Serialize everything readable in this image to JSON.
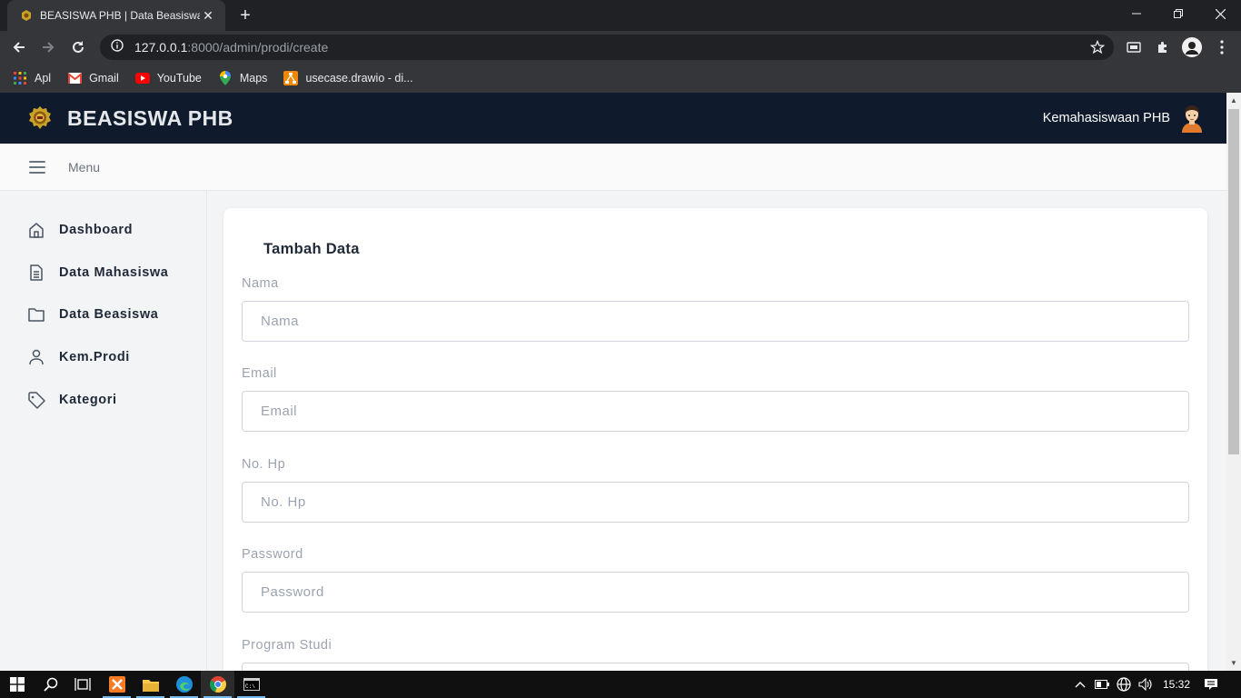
{
  "browser": {
    "tab_title": "BEASISWA PHB | Data Beasiswa",
    "tab_close": "✕",
    "new_tab": "+",
    "url_host": "127.0.0.1",
    "url_rest": ":8000/admin/prodi/create",
    "bookmarks": [
      {
        "label": "Apl",
        "icon": "apps-grid-icon"
      },
      {
        "label": "Gmail",
        "icon": "gmail-icon"
      },
      {
        "label": "YouTube",
        "icon": "youtube-icon"
      },
      {
        "label": "Maps",
        "icon": "maps-icon"
      },
      {
        "label": "usecase.drawio - di...",
        "icon": "drawio-icon"
      }
    ]
  },
  "header": {
    "brand": "BEASISWA PHB",
    "user": "Kemahasiswaan PHB"
  },
  "menubar": {
    "label": "Menu"
  },
  "sidebar": {
    "items": [
      {
        "label": "Dashboard",
        "icon": "home-icon"
      },
      {
        "label": "Data Mahasiswa",
        "icon": "document-icon"
      },
      {
        "label": "Data Beasiswa",
        "icon": "folder-icon"
      },
      {
        "label": "Kem.Prodi",
        "icon": "user-icon"
      },
      {
        "label": "Kategori",
        "icon": "tag-icon"
      }
    ]
  },
  "form": {
    "title": "Tambah Data",
    "fields": [
      {
        "label": "Nama",
        "placeholder": "Nama"
      },
      {
        "label": "Email",
        "placeholder": "Email"
      },
      {
        "label": "No. Hp",
        "placeholder": "No. Hp"
      },
      {
        "label": "Password",
        "placeholder": "Password"
      },
      {
        "label": "Program Studi",
        "placeholder": ""
      }
    ]
  },
  "taskbar": {
    "time": "15:32"
  },
  "colors": {
    "header_bg": "#0f1b2d",
    "chrome_bg": "#35363a",
    "tabstrip_bg": "#202124"
  }
}
